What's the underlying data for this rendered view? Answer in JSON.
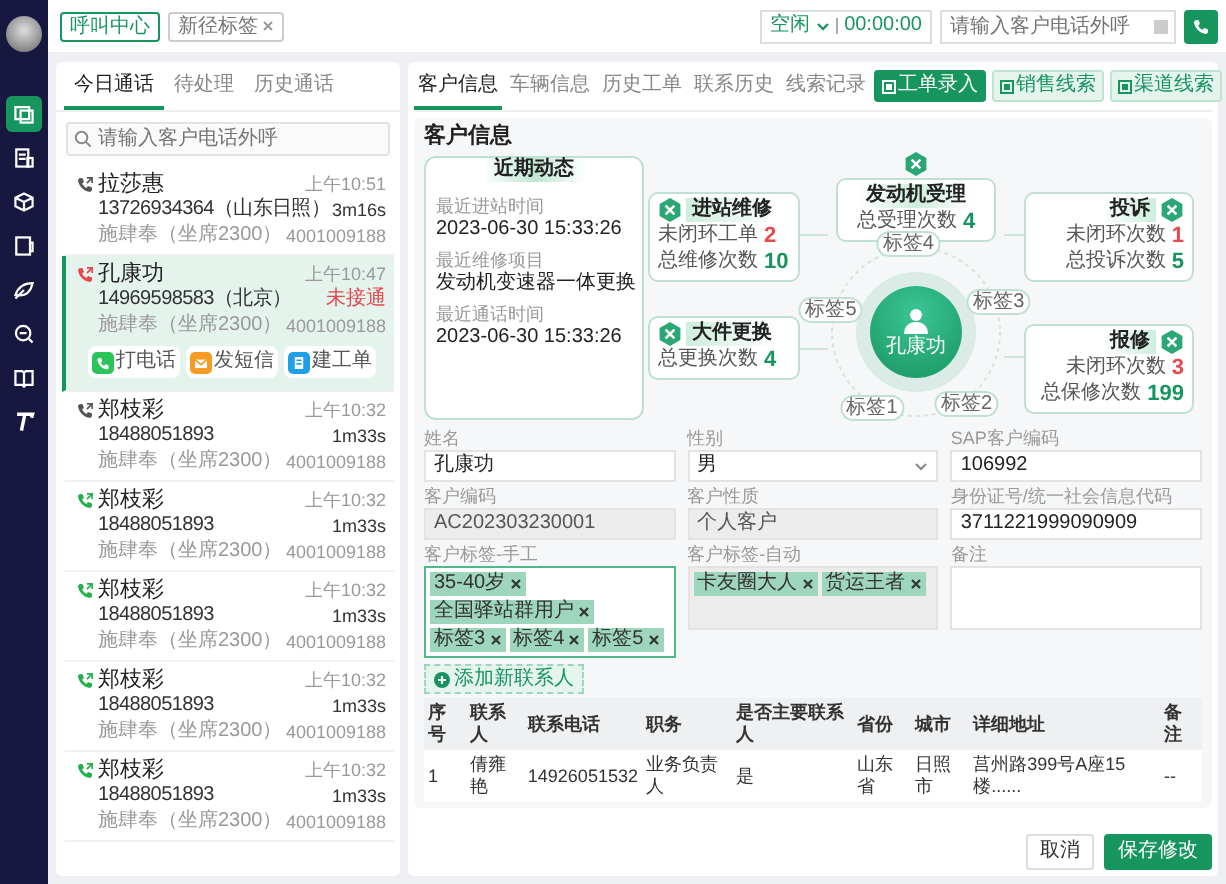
{
  "sidebar": {
    "items": [
      {
        "selected": true
      },
      {
        "selected": false
      },
      {
        "selected": false
      },
      {
        "selected": false
      },
      {
        "selected": false
      },
      {
        "selected": false
      },
      {
        "selected": false
      },
      {
        "selected": false
      }
    ]
  },
  "top_bar": {
    "tags": [
      {
        "label": "呼叫中心",
        "selected": true,
        "closable": false
      },
      {
        "label": "新径标签",
        "selected": false,
        "closable": true
      }
    ],
    "agent_status": "空闲",
    "timer": "00:00:00",
    "dial": {
      "placeholder": "请输入客户电话外呼"
    }
  },
  "call_panel": {
    "tabs": [
      {
        "label": "今日通话",
        "selected": true
      },
      {
        "label": "待处理",
        "selected": false
      },
      {
        "label": "历史通话",
        "selected": false
      }
    ],
    "search": {
      "placeholder": "请输入客户电话外呼"
    },
    "calls": [
      {
        "name": "拉莎惠",
        "time": "上午10:51",
        "phone": "13726934364（山东日照）",
        "duration": "3m16s",
        "missed": false,
        "agent": "施肆奉（坐席2300）",
        "line": "4001009188",
        "kind": "ended",
        "selected": false
      },
      {
        "name": "孔康功",
        "time": "上午10:47",
        "phone": "14969598583（北京）",
        "duration": "未接通",
        "missed": true,
        "agent": "施肆奉（坐席2300）",
        "line": "4001009188",
        "kind": "missed",
        "selected": true,
        "actions": [
          {
            "label": "打电话",
            "kind": "call"
          },
          {
            "label": "发短信",
            "kind": "sms"
          },
          {
            "label": "建工单",
            "kind": "ticket"
          }
        ]
      },
      {
        "name": "郑枝彩",
        "time": "上午10:32",
        "phone": "18488051893",
        "duration": "1m33s",
        "missed": false,
        "agent": "施肆奉（坐席2300）",
        "line": "4001009188",
        "kind": "ended",
        "selected": false
      },
      {
        "name": "郑枝彩",
        "time": "上午10:32",
        "phone": "18488051893",
        "duration": "1m33s",
        "missed": false,
        "agent": "施肆奉（坐席2300）",
        "line": "4001009188",
        "kind": "connected",
        "selected": false
      },
      {
        "name": "郑枝彩",
        "time": "上午10:32",
        "phone": "18488051893",
        "duration": "1m33s",
        "missed": false,
        "agent": "施肆奉（坐席2300）",
        "line": "4001009188",
        "kind": "connected",
        "selected": false
      },
      {
        "name": "郑枝彩",
        "time": "上午10:32",
        "phone": "18488051893",
        "duration": "1m33s",
        "missed": false,
        "agent": "施肆奉（坐席2300）",
        "line": "4001009188",
        "kind": "connected",
        "selected": false
      },
      {
        "name": "郑枝彩",
        "time": "上午10:32",
        "phone": "18488051893",
        "duration": "1m33s",
        "missed": false,
        "agent": "施肆奉（坐席2300）",
        "line": "4001009188",
        "kind": "connected",
        "selected": false
      }
    ]
  },
  "customer_panel": {
    "tabs": [
      {
        "label": "客户信息",
        "selected": true
      },
      {
        "label": "车辆信息",
        "selected": false
      },
      {
        "label": "历史工单",
        "selected": false
      },
      {
        "label": "联系历史",
        "selected": false
      },
      {
        "label": "线索记录",
        "selected": false
      }
    ],
    "actions": [
      {
        "label": "工单录入",
        "kind": "primary"
      },
      {
        "label": "销售线索",
        "kind": "light"
      },
      {
        "label": "渠道线索",
        "kind": "light"
      }
    ],
    "section_title": "客户信息",
    "recent": {
      "title": "近期动态",
      "items": [
        {
          "label": "最近进站时间",
          "value": "2023-06-30 15:33:26"
        },
        {
          "label": "最近维修项目",
          "value": "发动机变速器一体更换"
        },
        {
          "label": "最近通话时间",
          "value": "2023-06-30 15:33:26"
        }
      ]
    },
    "center": {
      "name": "孔康功",
      "tags": [
        "标签4",
        "标签3",
        "标签2",
        "标签1",
        "标签5"
      ]
    },
    "stats": [
      {
        "title": "发动机受理",
        "rows": [
          {
            "label": "总受理次数",
            "value": "4",
            "alert": false
          }
        ]
      },
      {
        "title": "进站维修",
        "rows": [
          {
            "label": "未闭环工单",
            "value": "2",
            "alert": true
          },
          {
            "label": "总维修次数",
            "value": "10",
            "alert": false
          }
        ]
      },
      {
        "title": "投诉",
        "rows": [
          {
            "label": "未闭环次数",
            "value": "1",
            "alert": true
          },
          {
            "label": "总投诉次数",
            "value": "5",
            "alert": false
          }
        ]
      },
      {
        "title": "大件更换",
        "rows": [
          {
            "label": "总更换次数",
            "value": "4",
            "alert": false
          }
        ]
      },
      {
        "title": "报修",
        "rows": [
          {
            "label": "未闭环次数",
            "value": "3",
            "alert": true
          },
          {
            "label": "总保修次数",
            "value": "199",
            "alert": false
          }
        ]
      }
    ],
    "fields": [
      {
        "label": "姓名",
        "kind": "text",
        "value": "孔康功",
        "disabled": false,
        "focused": false
      },
      {
        "label": "性别",
        "kind": "select",
        "value": "男",
        "disabled": false,
        "focused": false
      },
      {
        "label": "SAP客户编码",
        "kind": "text",
        "value": "106992",
        "disabled": false,
        "focused": false
      },
      {
        "label": "客户编码",
        "kind": "text",
        "value": "AC202303230001",
        "disabled": true,
        "focused": false
      },
      {
        "label": "客户性质",
        "kind": "text",
        "value": "个人客户",
        "disabled": true,
        "focused": false
      },
      {
        "label": "身份证号/统一社会信息代码",
        "kind": "text",
        "value": "3711221999090909",
        "disabled": false,
        "focused": false
      },
      {
        "label": "客户标签-手工",
        "kind": "tags",
        "tags": [
          "35-40岁",
          "全国驿站群用户",
          "标签3",
          "标签4",
          "标签5"
        ],
        "disabled": false,
        "focused": true
      },
      {
        "label": "客户标签-自动",
        "kind": "tags",
        "tags": [
          "卡友圈大人",
          "货运王者"
        ],
        "disabled": true,
        "focused": false
      },
      {
        "label": "备注",
        "kind": "textarea",
        "disabled": false,
        "focused": false
      }
    ],
    "add_contact": "添加新联系人",
    "table": {
      "columns": [
        "序号",
        "联系人",
        "联系电话",
        "职务",
        "是否主要联系人",
        "省份",
        "城市",
        "详细地址",
        "备注"
      ],
      "rows": [
        [
          "1",
          "倩雍艳",
          "14926051532",
          "业务负责人",
          "是",
          "山东省",
          "日照市",
          "莒州路399号A座15楼......",
          "--"
        ]
      ]
    },
    "buttons": [
      {
        "label": "取消",
        "kind": "secondary"
      },
      {
        "label": "保存修改",
        "kind": "primary"
      }
    ]
  }
}
